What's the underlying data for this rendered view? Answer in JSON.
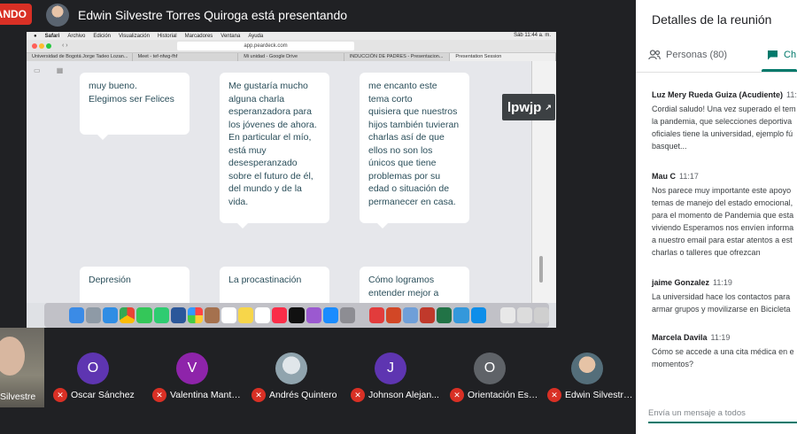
{
  "presenter": {
    "badge": "ANDO",
    "title": "Edwin Silvestre Torres Quiroga está presentando"
  },
  "shared_screen": {
    "mac_menu": [
      "Safari",
      "Archivo",
      "Edición",
      "Visualización",
      "Historial",
      "Marcadores",
      "Ventana",
      "Ayuda"
    ],
    "clock": "Sáb 11:44 a. m.",
    "url": "app.peardeck.com",
    "browser_tabs": [
      "Universidad de Bogotá Jorge Tadeo Lozan...",
      "Meet - tef-nfwg-fhf",
      "Mi unidad - Google Drive",
      "INDUCCIÓN DE PADRES - Presentacion...",
      "Presentation Session"
    ],
    "join_code": "lpwjp",
    "cards": [
      "muy bueno.\nElegimos ser Felices",
      "Me gustaría mucho\nalguna charla\nesperanzadora para\nlos jóvenes de ahora.\nEn particular el mío,\nestá muy\ndesesperanzado\nsobre el futuro de él,\ndel mundo y de la\nvida.",
      "me encanto este\ntema corto\nquisiera que nuestros\nhijos también tuvieran\ncharlas así de que\nellos no son los\núnicos que tiene\nproblemas por su\nedad o situación  de\npermanecer en casa.",
      "Depresión",
      "La procastinación",
      "Cómo logramos\nentender mejor a"
    ]
  },
  "participants": {
    "self_name": "Silvestre",
    "tiles": [
      {
        "initial": "O",
        "name": "Oscar Sánchez",
        "color": "#5e35b1"
      },
      {
        "initial": "V",
        "name": "Valentina Mantil...",
        "color": "#8e24aa"
      },
      {
        "initial": "",
        "name": "Andrés Quintero",
        "color": "#b0bec5"
      },
      {
        "initial": "J",
        "name": "Johnson Alejan...",
        "color": "#5e35b1"
      },
      {
        "initial": "O",
        "name": "Orientación Estu...",
        "color": "#5f6368"
      },
      {
        "initial": "",
        "name": "Edwin Silvestre ...",
        "color": "#78909c"
      }
    ]
  },
  "panel": {
    "title": "Detalles de la reunión",
    "tab_people": "Personas (80)",
    "tab_chat": "Ch",
    "messages": [
      {
        "author": "Luz Mery Rueda Guiza (Acudiente)",
        "time": "11:1",
        "text": "Cordial saludo! Una vez superado el tem\nla pandemia, que selecciones deportiva\noficiales tiene la universidad, ejemplo fú\nbasquet..."
      },
      {
        "author": "Mau C",
        "time": "11:17",
        "text": "Nos parece muy importante este apoyo\ntemas de manejo del estado emocional,\npara el momento de Pandemia que esta\nviviendo Esperamos nos envíen informa\na nuestro email para estar atentos a est\ncharlas o talleres que ofrezcan"
      },
      {
        "author": "jaime Gonzalez",
        "time": "11:19",
        "text": "La universidad hace los contactos para\narmar grupos y  movilizarse en Bicicleta"
      },
      {
        "author": "Marcela Davila",
        "time": "11:19",
        "text": "Cómo se accede a una cita médica en e\nmomentos?"
      }
    ],
    "input_placeholder": "Envía un mensaje a todos"
  }
}
